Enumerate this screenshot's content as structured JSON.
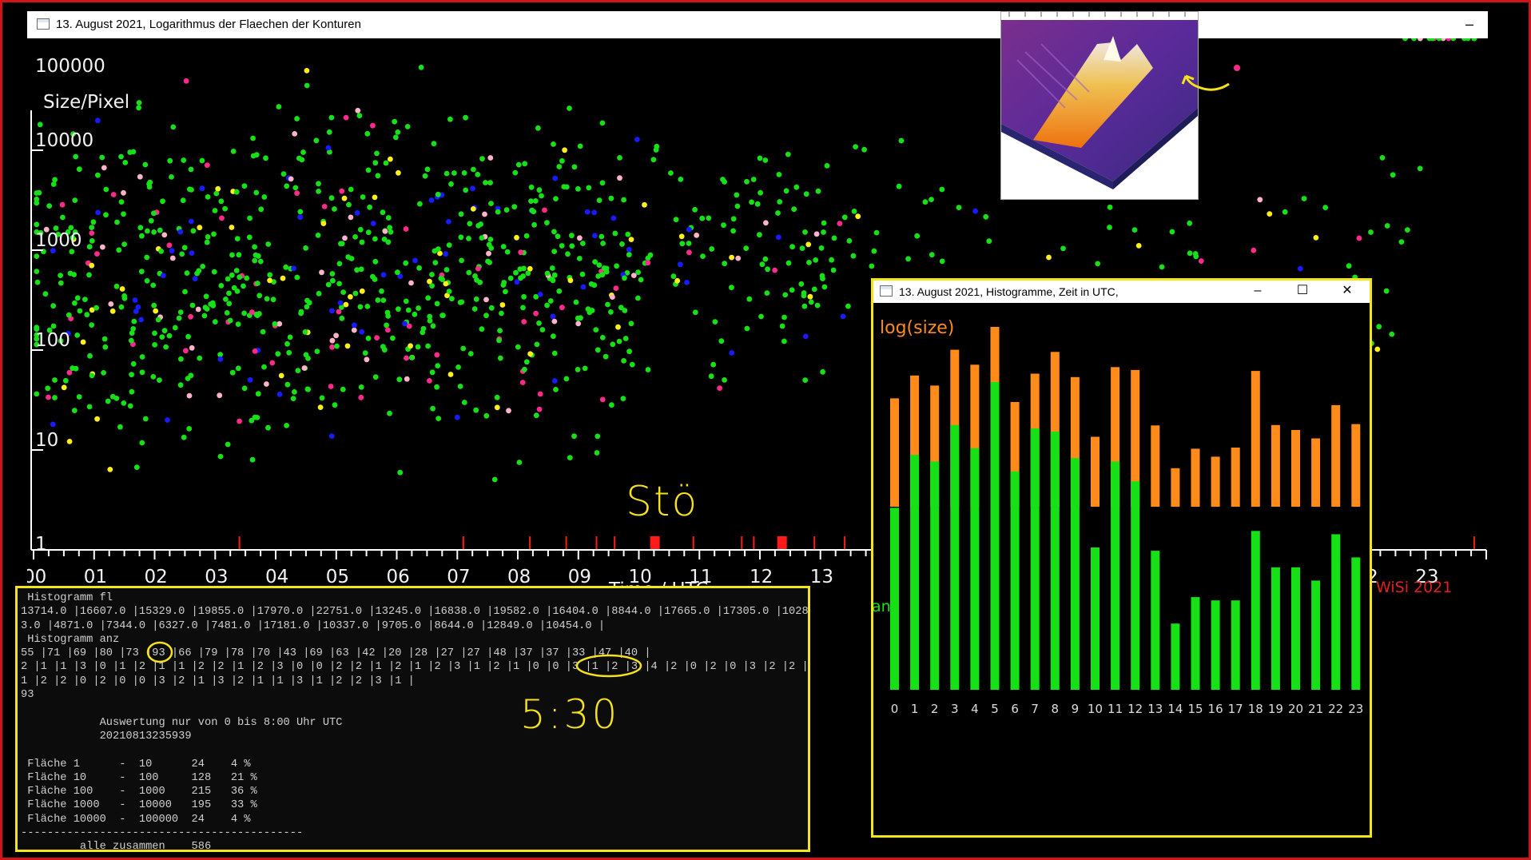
{
  "main_window": {
    "title": "13. August 2021, Logarithmus der Flaechen der Konturen",
    "minimize_glyph": "–",
    "y_axis_title": "Size/Pixel",
    "y_ticks": [
      "100000",
      "10000",
      "1000",
      "100",
      "10",
      "1"
    ],
    "x_axis_title": "Time / UTC",
    "x_ticks": [
      "00",
      "01",
      "02",
      "03",
      "04",
      "05",
      "06",
      "07",
      "08",
      "09",
      "10",
      "11",
      "12",
      "13",
      "14",
      "15",
      "16",
      "17",
      "18",
      "19",
      "20",
      "21",
      "22",
      "23"
    ],
    "credit": "WiSi 2021"
  },
  "chart_data": [
    {
      "type": "scatter",
      "title": "13. August 2021, Logarithmus der Flaechen der Konturen",
      "ylabel": "Size/Pixel",
      "xlabel": "Time / UTC",
      "y_scale": "log",
      "ylim": [
        1,
        100000
      ],
      "xlim": [
        0,
        24
      ],
      "series_colors": [
        "#16e016",
        "#ffef1a",
        "#ff2a8a",
        "#1a1aff",
        "#ffb3c8"
      ],
      "marker_color": "#16e016",
      "disturbance_marker_color": "#ff1a1a",
      "x": [
        0.1,
        0.2,
        0.3,
        0.4,
        0.5,
        0.6,
        0.7,
        0.8,
        0.9,
        1.0,
        1.1,
        1.2,
        1.3,
        1.4,
        1.5,
        1.6,
        1.7,
        1.8,
        1.9,
        2.0,
        2.1,
        2.2,
        2.3,
        2.4,
        2.5,
        2.6,
        2.7,
        2.8,
        2.9,
        3.0,
        3.1,
        3.2,
        3.3,
        3.4,
        3.5,
        3.6,
        3.7,
        3.8,
        3.9,
        4.0,
        4.1,
        4.2,
        4.3,
        4.4,
        4.5,
        4.6,
        4.7,
        4.8,
        4.9,
        5.0,
        5.1,
        5.2,
        5.3,
        5.4,
        5.5,
        5.6,
        5.7,
        5.8,
        5.9,
        6.0,
        6.1,
        6.2,
        6.3,
        6.4,
        6.5,
        6.6,
        6.7,
        6.8,
        6.9,
        7.0,
        7.1,
        7.2,
        7.3,
        7.4,
        7.5,
        7.6,
        7.7,
        7.8,
        7.9,
        8.0,
        8.1,
        8.2,
        8.3,
        8.4,
        8.5,
        8.6,
        8.7,
        8.8,
        8.9,
        9.0,
        9.1,
        9.2,
        9.3,
        9.4,
        9.5,
        9.6,
        9.7,
        9.8,
        9.9,
        10.0,
        10.5,
        11.0,
        11.2,
        11.4,
        11.6,
        11.8,
        12.0,
        12.2,
        12.4,
        12.6,
        12.8,
        13.0,
        13.2,
        13.5,
        14.0,
        15.0,
        16.0,
        17.0,
        18.0,
        19.0,
        20.0,
        21.0,
        22.0,
        22.5,
        23.0,
        23.5
      ],
      "y": [
        3000,
        200,
        800,
        40,
        1500,
        120,
        5000,
        400,
        60,
        900,
        2500,
        150,
        700,
        30,
        8000,
        350,
        1200,
        90,
        600,
        2000,
        250,
        4000,
        80,
        1100,
        300,
        9000,
        500,
        70,
        1800,
        650,
        140,
        3500,
        20,
        950,
        420,
        2600,
        110,
        760,
        45,
        1400,
        330,
        6000,
        180,
        870,
        55,
        2300,
        480,
        12000,
        130,
        1000,
        260,
        3800,
        75,
        560,
        1600,
        210,
        7000,
        95,
        640,
        2900,
        160,
        440,
        35,
        1300,
        780,
        15000,
        230,
        520,
        100,
        2700,
        380,
        4500,
        65,
        990,
        1700,
        290,
        850,
        25,
        3300,
        470,
        1150,
        140,
        690,
        2100,
        340,
        5500,
        85,
        610,
        1950,
        240,
        820,
        50,
        3000,
        410,
        1250,
        170,
        560,
        2400,
        320,
        700,
        2000,
        1500,
        900,
        400,
        250,
        1800,
        600,
        3000,
        1200,
        700,
        300,
        500,
        2000,
        1500,
        3000,
        1000,
        800,
        2500,
        600,
        1200,
        900,
        1800,
        300,
        2200
      ],
      "disturbances_x": [
        3.4,
        7.1,
        8.2,
        8.8,
        9.3,
        9.6,
        10.2,
        10.3,
        10.9,
        11.7,
        11.9,
        12.3,
        12.4,
        12.9,
        13.4,
        23.8
      ]
    },
    {
      "type": "bar",
      "title": "13. August 2021, Histogramme, Zeit in UTC,",
      "label_upper": "log(size)",
      "label_lower": "anz",
      "categories": [
        "0",
        "1",
        "2",
        "3",
        "4",
        "5",
        "6",
        "7",
        "8",
        "9",
        "10",
        "11",
        "12",
        "13",
        "14",
        "15",
        "16",
        "17",
        "18",
        "19",
        "20",
        "21",
        "22",
        "23"
      ],
      "series": [
        {
          "name": "log(size)",
          "color": "#ff8c1a",
          "values": [
            13714.0,
            16607.0,
            15329.0,
            19855.0,
            17970.0,
            22751.0,
            13245.0,
            16838.0,
            19582.0,
            16404.0,
            8844.0,
            17665.0,
            17305.0,
            10283.0,
            4871.0,
            7344.0,
            6327.0,
            7481.0,
            17181.0,
            10337.0,
            9705.0,
            8644.0,
            12849.0,
            10454.0
          ]
        },
        {
          "name": "anz",
          "color": "#16e016",
          "values": [
            55,
            71,
            69,
            80,
            73,
            93,
            66,
            79,
            78,
            70,
            43,
            69,
            63,
            42,
            20,
            28,
            27,
            27,
            48,
            37,
            37,
            33,
            47,
            40
          ]
        }
      ]
    }
  ],
  "hist_window": {
    "title": "13. August 2021, Histogramme, Zeit in UTC,",
    "minimize_glyph": "–",
    "maximize_glyph": "☐",
    "close_glyph": "✕"
  },
  "console": {
    "lines": [
      " Histogramm fl",
      "13714.0 |16607.0 |15329.0 |19855.0 |17970.0 |22751.0 |13245.0 |16838.0 |19582.0 |16404.0 |8844.0 |17665.0 |17305.0 |1028",
      "3.0 |4871.0 |7344.0 |6327.0 |7481.0 |17181.0 |10337.0 |9705.0 |8644.0 |12849.0 |10454.0 |",
      " Histogramm anz",
      "55 |71 |69 |80 |73 |93 |66 |79 |78 |70 |43 |69 |63 |42 |20 |28 |27 |27 |48 |37 |37 |33 |47 |40 |",
      "2 |1 |1 |3 |0 |1 |2 |1 |1 |2 |2 |1 |2 |3 |0 |0 |2 |2 |1 |2 |1 |2 |3 |1 |2 |1 |0 |0 |3 |1 |2 |3 |4 |2 |0 |2 |0 |3 |2 |2 |0 |1 |",
      "1 |2 |2 |0 |2 |0 |0 |3 |2 |1 |3 |2 |1 |1 |3 |1 |2 |2 |3 |1 |",
      "93",
      "",
      "            Auswertung nur von 0 bis 8:00 Uhr UTC",
      "            20210813235939",
      "",
      " Fläche 1      -  10      24    4 %",
      " Fläche 10     -  100     128   21 %",
      " Fläche 100    -  1000    215   36 %",
      " Fläche 1000   -  10000   195   33 %",
      " Fläche 10000  -  100000  24    4 %",
      "-------------------------------------------",
      "         alle zusammen    586"
    ]
  },
  "annotations": {
    "stoer": "Stö",
    "time": "5:30"
  }
}
